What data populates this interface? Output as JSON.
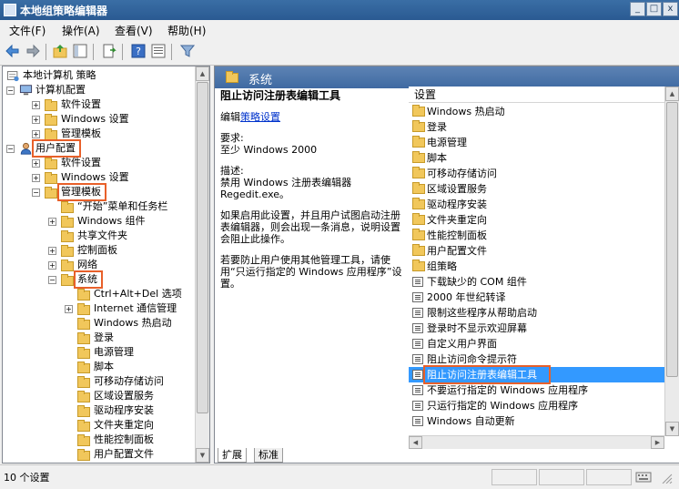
{
  "window": {
    "title": "本地组策略编辑器"
  },
  "menu": [
    "文件(F)",
    "操作(A)",
    "查看(V)",
    "帮助(H)"
  ],
  "tree": [
    {
      "label": "本地计算机 策略",
      "indent": 0,
      "expander": "",
      "icon": "computer-policy-icon"
    },
    {
      "label": "计算机配置",
      "indent": 1,
      "expander": "−",
      "icon": "computer-icon"
    },
    {
      "label": "软件设置",
      "indent": 2,
      "expander": "+",
      "icon": "folder-icon"
    },
    {
      "label": "Windows 设置",
      "indent": 2,
      "expander": "+",
      "icon": "folder-icon"
    },
    {
      "label": "管理模板",
      "indent": 2,
      "expander": "+",
      "icon": "folder-icon"
    },
    {
      "label": "用户配置",
      "indent": 1,
      "expander": "−",
      "icon": "user-icon",
      "highlight": true
    },
    {
      "label": "软件设置",
      "indent": 2,
      "expander": "+",
      "icon": "folder-icon"
    },
    {
      "label": "Windows 设置",
      "indent": 2,
      "expander": "+",
      "icon": "folder-icon"
    },
    {
      "label": "管理模板",
      "indent": 2,
      "expander": "−",
      "icon": "folder-icon",
      "highlight": true
    },
    {
      "label": "“开始”菜单和任务栏",
      "indent": 3,
      "expander": "",
      "icon": "folder-icon"
    },
    {
      "label": "Windows 组件",
      "indent": 3,
      "expander": "+",
      "icon": "folder-icon"
    },
    {
      "label": "共享文件夹",
      "indent": 3,
      "expander": "",
      "icon": "folder-icon"
    },
    {
      "label": "控制面板",
      "indent": 3,
      "expander": "+",
      "icon": "folder-icon"
    },
    {
      "label": "网络",
      "indent": 3,
      "expander": "+",
      "icon": "folder-icon"
    },
    {
      "label": "系统",
      "indent": 3,
      "expander": "−",
      "icon": "folder-icon",
      "highlight": true
    },
    {
      "label": "Ctrl+Alt+Del 选项",
      "indent": 4,
      "expander": "",
      "icon": "folder-icon"
    },
    {
      "label": "Internet 通信管理",
      "indent": 4,
      "expander": "+",
      "icon": "folder-icon"
    },
    {
      "label": "Windows 热启动",
      "indent": 4,
      "expander": "",
      "icon": "folder-icon"
    },
    {
      "label": "登录",
      "indent": 4,
      "expander": "",
      "icon": "folder-icon"
    },
    {
      "label": "电源管理",
      "indent": 4,
      "expander": "",
      "icon": "folder-icon"
    },
    {
      "label": "脚本",
      "indent": 4,
      "expander": "",
      "icon": "folder-icon"
    },
    {
      "label": "可移动存储访问",
      "indent": 4,
      "expander": "",
      "icon": "folder-icon"
    },
    {
      "label": "区域设置服务",
      "indent": 4,
      "expander": "",
      "icon": "folder-icon"
    },
    {
      "label": "驱动程序安装",
      "indent": 4,
      "expander": "",
      "icon": "folder-icon"
    },
    {
      "label": "文件夹重定向",
      "indent": 4,
      "expander": "",
      "icon": "folder-icon"
    },
    {
      "label": "性能控制面板",
      "indent": 4,
      "expander": "",
      "icon": "folder-icon"
    },
    {
      "label": "用户配置文件",
      "indent": 4,
      "expander": "",
      "icon": "folder-icon"
    }
  ],
  "right": {
    "header": "系统",
    "desc": {
      "title": "阻止访问注册表编辑工具",
      "edit_prefix": "编辑",
      "edit_link": "策略设置",
      "req_label": "要求:",
      "req_value": "至少 Windows 2000",
      "desc_label": "描述:",
      "desc_line1": "禁用 Windows 注册表编辑器",
      "desc_line2": "Regedit.exe。",
      "para1": "如果启用此设置，并且用户试图启动注册表编辑器，则会出现一条消息，说明设置会阻止此操作。",
      "para2": "若要防止用户使用其他管理工具，请使用“只运行指定的 Windows 应用程序”设置。"
    },
    "list_header": "设置",
    "items": [
      {
        "label": "Windows 热启动",
        "type": "folder"
      },
      {
        "label": "登录",
        "type": "folder"
      },
      {
        "label": "电源管理",
        "type": "folder"
      },
      {
        "label": "脚本",
        "type": "folder"
      },
      {
        "label": "可移动存储访问",
        "type": "folder"
      },
      {
        "label": "区域设置服务",
        "type": "folder"
      },
      {
        "label": "驱动程序安装",
        "type": "folder"
      },
      {
        "label": "文件夹重定向",
        "type": "folder"
      },
      {
        "label": "性能控制面板",
        "type": "folder"
      },
      {
        "label": "用户配置文件",
        "type": "folder"
      },
      {
        "label": "组策略",
        "type": "folder"
      },
      {
        "label": "下载缺少的 COM 组件",
        "type": "setting"
      },
      {
        "label": "2000 年世纪转译",
        "type": "setting"
      },
      {
        "label": "限制这些程序从帮助启动",
        "type": "setting"
      },
      {
        "label": "登录时不显示欢迎屏幕",
        "type": "setting"
      },
      {
        "label": "自定义用户界面",
        "type": "setting"
      },
      {
        "label": "阻止访问命令提示符",
        "type": "setting"
      },
      {
        "label": "阻止访问注册表编辑工具",
        "type": "setting",
        "selected": true
      },
      {
        "label": "不要运行指定的 Windows 应用程序",
        "type": "setting"
      },
      {
        "label": "只运行指定的 Windows 应用程序",
        "type": "setting"
      },
      {
        "label": "Windows 自动更新",
        "type": "setting"
      }
    ],
    "tabs": [
      "扩展",
      "标准"
    ]
  },
  "status": {
    "text": "10 个设置"
  }
}
